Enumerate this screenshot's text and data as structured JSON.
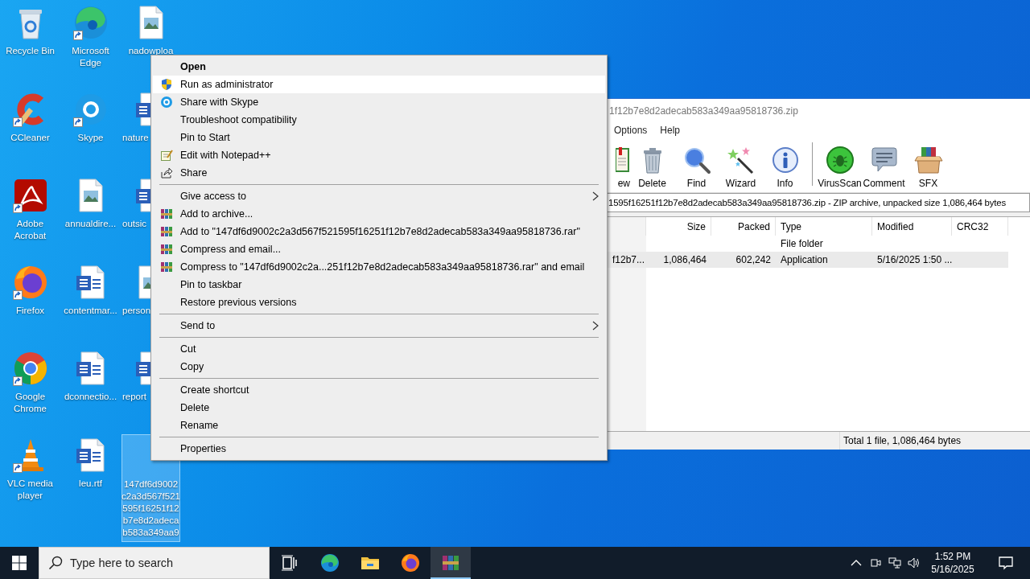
{
  "desktop": {
    "icons": [
      {
        "label": "Recycle Bin",
        "kind": "recycle",
        "shortcut": false,
        "selected": false
      },
      {
        "label": "CCleaner",
        "kind": "ccleaner",
        "shortcut": true,
        "selected": false
      },
      {
        "label": "Adobe Acrobat",
        "kind": "acrobat",
        "shortcut": true,
        "selected": false
      },
      {
        "label": "Firefox",
        "kind": "firefox",
        "shortcut": true,
        "selected": false
      },
      {
        "label": "Google Chrome",
        "kind": "chrome",
        "shortcut": true,
        "selected": false
      },
      {
        "label": "VLC media player",
        "kind": "vlc",
        "shortcut": true,
        "selected": false
      },
      {
        "label": "Microsoft Edge",
        "kind": "edge",
        "shortcut": true,
        "selected": false
      },
      {
        "label": "Skype",
        "kind": "skype",
        "shortcut": true,
        "selected": false
      },
      {
        "label": "annualdire...",
        "kind": "image",
        "shortcut": false,
        "selected": false
      },
      {
        "label": "contentmar...",
        "kind": "word",
        "shortcut": false,
        "selected": false
      },
      {
        "label": "dconnectio...",
        "kind": "word",
        "shortcut": false,
        "selected": false
      },
      {
        "label": "leu.rtf",
        "kind": "word",
        "shortcut": false,
        "selected": false
      },
      {
        "label": "nadowploa",
        "kind": "image",
        "shortcut": false,
        "selected": false
      },
      {
        "label": "nature",
        "kind": "word",
        "shortcut": false,
        "selected": false
      },
      {
        "label": "outsic",
        "kind": "word",
        "shortcut": false,
        "selected": false
      },
      {
        "label": "person",
        "kind": "image",
        "shortcut": false,
        "selected": false
      },
      {
        "label": "report",
        "kind": "word",
        "shortcut": false,
        "selected": false
      },
      {
        "label_lines": [
          "147df6d9002",
          "c2a3d567f521",
          "595f16251f12",
          "b7e8d2adeca",
          "b583a349aa9"
        ],
        "kind": "blank",
        "shortcut": false,
        "selected": true
      }
    ]
  },
  "archive_window": {
    "title": "1f12b7e8d2adecab583a349aa95818736.zip",
    "menu": [
      "Options",
      "Help"
    ],
    "toolbar": [
      {
        "label": "ew",
        "kind": "view"
      },
      {
        "label": "Delete",
        "kind": "delete"
      },
      {
        "label": "Find",
        "kind": "find"
      },
      {
        "label": "Wizard",
        "kind": "wizard"
      },
      {
        "label": "Info",
        "kind": "info"
      },
      {
        "label": "VirusScan",
        "kind": "virusscan"
      },
      {
        "label": "Comment",
        "kind": "comment"
      },
      {
        "label": "SFX",
        "kind": "sfx"
      }
    ],
    "path": "1595f16251f12b7e8d2adecab583a349aa95818736.zip - ZIP archive, unpacked size 1,086,464 bytes",
    "columns": [
      "Size",
      "Packed",
      "Type",
      "Modified",
      "CRC32"
    ],
    "rows": [
      {
        "name": "",
        "cells": [
          "",
          "",
          "File folder",
          "",
          ""
        ],
        "selected": false
      },
      {
        "name": "f12b7...",
        "cells": [
          "1,086,464",
          "602,242",
          "Application",
          "5/16/2025 1:50 ...",
          ""
        ],
        "selected": true
      }
    ],
    "status": "Total 1 file, 1,086,464 bytes"
  },
  "context_menu": {
    "items": [
      {
        "kind": "item",
        "label": "Open",
        "default": true,
        "selected": false,
        "submenu": false
      },
      {
        "kind": "shield",
        "label": "Run as administrator",
        "default": false,
        "selected": true,
        "submenu": false
      },
      {
        "kind": "skype",
        "label": "Share with Skype",
        "default": false,
        "selected": false,
        "submenu": false
      },
      {
        "kind": "item",
        "label": "Troubleshoot compatibility",
        "default": false,
        "selected": false,
        "submenu": false
      },
      {
        "kind": "item",
        "label": "Pin to Start",
        "default": false,
        "selected": false,
        "submenu": false
      },
      {
        "kind": "notepad",
        "label": "Edit with Notepad++",
        "default": false,
        "selected": false,
        "submenu": false
      },
      {
        "kind": "share",
        "label": "Share",
        "default": false,
        "selected": false,
        "submenu": false
      },
      {
        "kind": "separator"
      },
      {
        "kind": "item",
        "label": "Give access to",
        "default": false,
        "selected": false,
        "submenu": true
      },
      {
        "kind": "archive",
        "label": "Add to archive...",
        "default": false,
        "selected": false,
        "submenu": false
      },
      {
        "kind": "archive",
        "label": "Add to \"147df6d9002c2a3d567f521595f16251f12b7e8d2adecab583a349aa95818736.rar\"",
        "default": false,
        "selected": false,
        "submenu": false
      },
      {
        "kind": "archive",
        "label": "Compress and email...",
        "default": false,
        "selected": false,
        "submenu": false
      },
      {
        "kind": "archive",
        "label": "Compress to \"147df6d9002c2a...251f12b7e8d2adecab583a349aa95818736.rar\" and email",
        "default": false,
        "selected": false,
        "submenu": false
      },
      {
        "kind": "item",
        "label": "Pin to taskbar",
        "default": false,
        "selected": false,
        "submenu": false
      },
      {
        "kind": "item",
        "label": "Restore previous versions",
        "default": false,
        "selected": false,
        "submenu": false
      },
      {
        "kind": "separator"
      },
      {
        "kind": "item",
        "label": "Send to",
        "default": false,
        "selected": false,
        "submenu": true
      },
      {
        "kind": "separator"
      },
      {
        "kind": "item",
        "label": "Cut",
        "default": false,
        "selected": false,
        "submenu": false
      },
      {
        "kind": "item",
        "label": "Copy",
        "default": false,
        "selected": false,
        "submenu": false
      },
      {
        "kind": "separator"
      },
      {
        "kind": "item",
        "label": "Create shortcut",
        "default": false,
        "selected": false,
        "submenu": false
      },
      {
        "kind": "item",
        "label": "Delete",
        "default": false,
        "selected": false,
        "submenu": false
      },
      {
        "kind": "item",
        "label": "Rename",
        "default": false,
        "selected": false,
        "submenu": false
      },
      {
        "kind": "separator"
      },
      {
        "kind": "item",
        "label": "Properties",
        "default": false,
        "selected": false,
        "submenu": false
      }
    ]
  },
  "taskbar": {
    "search": {
      "placeholder": "Type here to search"
    },
    "apps": [
      {
        "kind": "taskview",
        "active": false
      },
      {
        "kind": "edge",
        "active": false
      },
      {
        "kind": "folder",
        "active": false
      },
      {
        "kind": "firefox",
        "active": false
      },
      {
        "kind": "archive",
        "active": true
      }
    ],
    "clock": {
      "time": "1:52 PM",
      "date": "5/16/2025"
    }
  }
}
